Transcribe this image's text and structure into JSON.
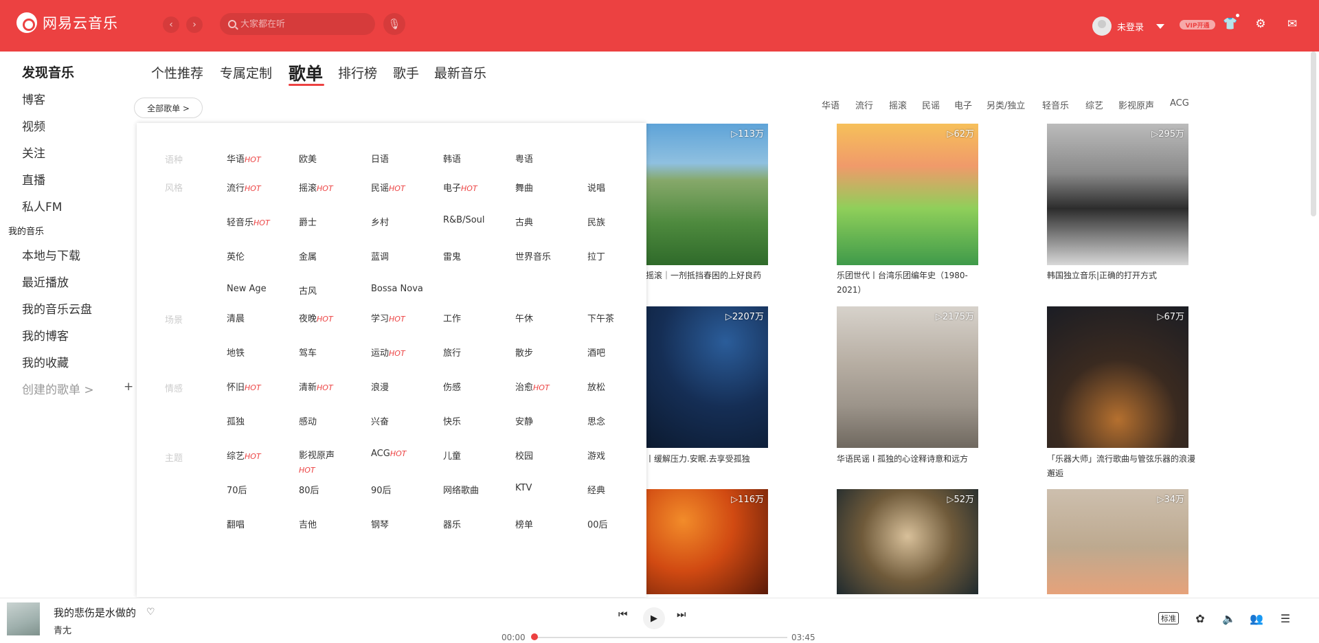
{
  "app": {
    "name": "网易云音乐"
  },
  "header": {
    "search_placeholder": "大家都在听",
    "user": "未登录",
    "vip": "VIP开通",
    "back_icon": "chevron-left-icon",
    "forward_icon": "chevron-right-icon"
  },
  "sidebar": {
    "discover": "发现音乐",
    "blog": "博客",
    "video": "视频",
    "follow": "关注",
    "live": "直播",
    "fm": "私人FM",
    "my_music": "我的音乐",
    "local": "本地与下载",
    "recent": "最近播放",
    "cloud": "我的音乐云盘",
    "my_blog": "我的博客",
    "favorites": "我的收藏",
    "created": "创建的歌单 >"
  },
  "tabs": [
    "个性推荐",
    "专属定制",
    "歌单",
    "排行榜",
    "歌手",
    "最新音乐"
  ],
  "all_playlists": "全部歌单 >",
  "hot_tags": [
    "华语",
    "流行",
    "摇滚",
    "民谣",
    "电子",
    "另类/独立",
    "轻音乐",
    "综艺",
    "影视原声",
    "ACG"
  ],
  "hot_mark": "HOT",
  "dropdown": {
    "language": {
      "label": "语种",
      "items": [
        "华语",
        "欧美",
        "日语",
        "韩语",
        "粤语"
      ]
    },
    "style": {
      "label": "风格",
      "items": [
        "流行",
        "摇滚",
        "民谣",
        "电子",
        "舞曲",
        "说唱",
        "轻音乐",
        "爵士",
        "乡村",
        "R&B/Soul",
        "古典",
        "民族",
        "英伦",
        "金属",
        "蓝调",
        "雷鬼",
        "世界音乐",
        "拉丁",
        "New Age",
        "古风",
        "Bossa Nova"
      ]
    },
    "scene": {
      "label": "场景",
      "items": [
        "清晨",
        "夜晚",
        "学习",
        "工作",
        "午休",
        "下午茶",
        "地铁",
        "驾车",
        "运动",
        "旅行",
        "散步",
        "酒吧"
      ]
    },
    "emotion": {
      "label": "情感",
      "items": [
        "怀旧",
        "清新",
        "浪漫",
        "伤感",
        "治愈",
        "放松",
        "孤独",
        "感动",
        "兴奋",
        "快乐",
        "安静",
        "思念"
      ]
    },
    "theme": {
      "label": "主题",
      "items": [
        "综艺",
        "影视原声",
        "ACG",
        "儿童",
        "校园",
        "游戏",
        "70后",
        "80后",
        "90后",
        "网络歌曲",
        "KTV",
        "经典",
        "翻唱",
        "吉他",
        "钢琴",
        "器乐",
        "榜单",
        "00后"
      ]
    }
  },
  "cards": [
    {
      "count": "▷113万",
      "title": "摇滚｜一剂抵挡春困的上好良药"
    },
    {
      "count": "▷62万",
      "title": "乐团世代丨台湾乐团编年史（1980-2021）"
    },
    {
      "count": "▷295万",
      "title": "韩国独立音乐|正确的打开方式"
    },
    {
      "count": "▷2207万",
      "title": "丨缓解压力.安眠.去享受孤独"
    },
    {
      "count": "▷2175万",
      "title": "华语民谣 I 孤独的心诠释诗意和远方"
    },
    {
      "count": "▷67万",
      "title": "「乐器大师」流行歌曲与管弦乐器的浪漫邂逅"
    },
    {
      "count": "▷116万",
      "title": ""
    },
    {
      "count": "▷52万",
      "title": ""
    },
    {
      "count": "▷34万",
      "title": ""
    }
  ],
  "player": {
    "song": "我的悲伤是水做的",
    "artist": "青尢",
    "current": "00:00",
    "duration": "03:45",
    "progress": 0.0,
    "quality": "标准"
  },
  "colors": {
    "accent": "#ec4141"
  }
}
